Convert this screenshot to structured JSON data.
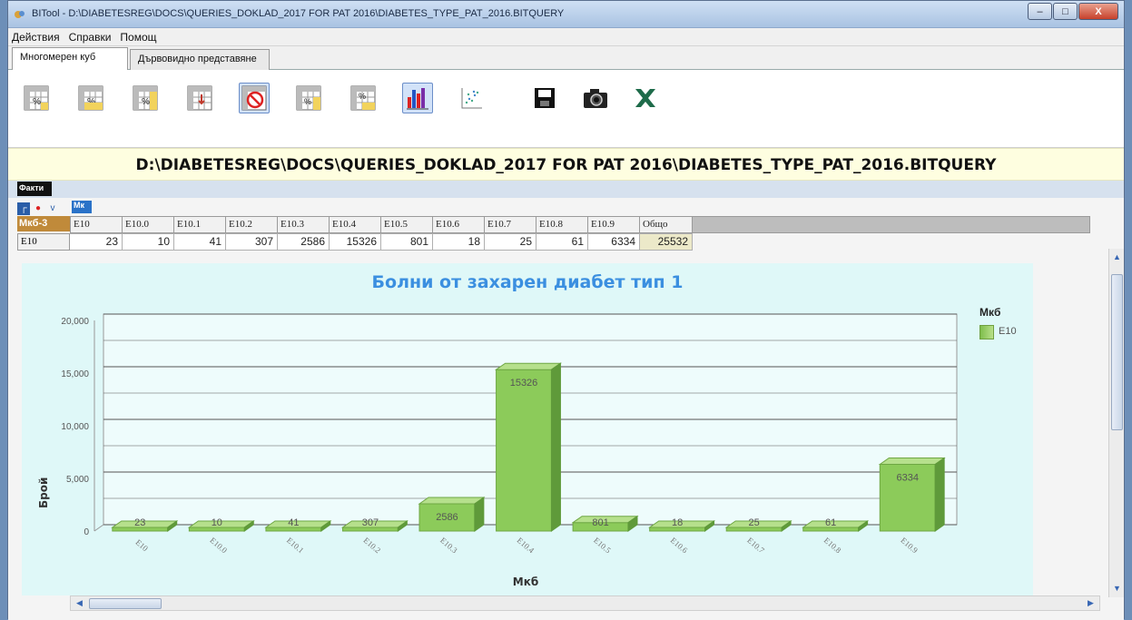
{
  "window": {
    "title": "BITool - D:\\DIABETESREG\\DOCS\\QUERIES_DOKLAD_2017 FOR PAT 2016\\DIABETES_TYPE_PAT_2016.BITQUERY",
    "minimize": "–",
    "maximize": "□",
    "close": "X"
  },
  "menu": [
    "Действия",
    "Справки",
    "Помощ"
  ],
  "tabs": [
    "Многомерен куб",
    "Дървовидно представяне"
  ],
  "toolbar": {
    "icons": [
      "percent-grid-icon",
      "percent-grid-icon",
      "percent-grid-icon",
      "sort-grid-icon",
      "filter-grid-icon",
      "count-grid-icon",
      "count-grid-icon",
      "bar-chart-icon",
      "scatter-chart-icon",
      "save-icon",
      "camera-icon",
      "excel-icon"
    ]
  },
  "path": "D:\\DIABETESREG\\DOCS\\QUERIES_DOKLAD_2017 FOR PAT 2016\\DIABETES_TYPE_PAT_2016.BITQUERY",
  "facts_label": "Факти",
  "column_dim_label": "Мк",
  "row_dim_label": "Мкб-3",
  "grid": {
    "headers": [
      "E10",
      "E10.0",
      "E10.1",
      "E10.2",
      "E10.3",
      "E10.4",
      "E10.5",
      "E10.6",
      "E10.7",
      "E10.8",
      "E10.9",
      "Общо"
    ],
    "row_header": "E10",
    "values": [
      "23",
      "10",
      "41",
      "307",
      "2586",
      "15326",
      "801",
      "18",
      "25",
      "61",
      "6334",
      "25532"
    ]
  },
  "chart_data": {
    "type": "bar",
    "title": "Болни от захарен диабет тип 1",
    "xlabel": "Мкб",
    "ylabel": "Брой",
    "categories": [
      "E10",
      "E10.0",
      "E10.1",
      "E10.2",
      "E10.3",
      "E10.4",
      "E10.5",
      "E10.6",
      "E10.7",
      "E10.8",
      "E10.9"
    ],
    "series": [
      {
        "name": "E10",
        "values": [
          23,
          10,
          41,
          307,
          2586,
          15326,
          801,
          18,
          25,
          61,
          6334
        ]
      }
    ],
    "yticks": [
      "0",
      "5,000",
      "10,000",
      "15,000",
      "20,000"
    ],
    "ylim": [
      0,
      20000
    ],
    "grid": true,
    "legend": {
      "title": "Мкб",
      "placement": "right"
    },
    "bar_color": "#8ccb5a"
  }
}
